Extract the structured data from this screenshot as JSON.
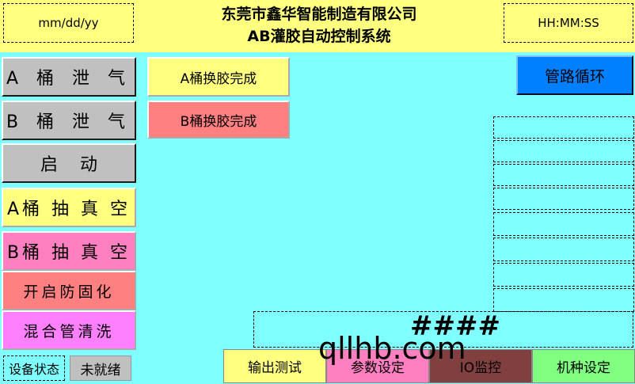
{
  "header": {
    "date_placeholder": "mm/dd/yy",
    "time_placeholder": "HH:MM:SS",
    "company": "东莞市鑫华智能制造有限公司",
    "system": "AB灌胶自动控制系统"
  },
  "left_buttons": [
    {
      "label": "A 桶 泄 气",
      "color": "#c0c0c0"
    },
    {
      "label": "B 桶 泄 气",
      "color": "#c0c0c0"
    },
    {
      "label": "启    动",
      "color": "#c0c0c0"
    },
    {
      "label": "A桶 抽 真 空",
      "color": "#ffff80"
    },
    {
      "label": "B桶 抽 真 空",
      "color": "#ff80c0"
    },
    {
      "label": "开启防固化",
      "color": "#ff8080"
    },
    {
      "label": "混合管清洗",
      "color": "#ff80ff"
    }
  ],
  "status": {
    "label": "设备状态",
    "value": "未就绪"
  },
  "indicators": [
    {
      "label": "A桶换胶完成",
      "color": "#ffff80"
    },
    {
      "label": "B桶换胶完成",
      "color": "#ff8080"
    }
  ],
  "pipe_button": {
    "label": "管路循环",
    "color": "#0080ff"
  },
  "readout_value": "####",
  "bottom_buttons": [
    {
      "label": "输出测试",
      "color": "#ffff80"
    },
    {
      "label": "参数设定",
      "color": "#ff80c0"
    },
    {
      "label": "IO监控",
      "color": "#804040"
    },
    {
      "label": "机种设定",
      "color": "#80ff80"
    }
  ],
  "watermark": "qllhb.com"
}
